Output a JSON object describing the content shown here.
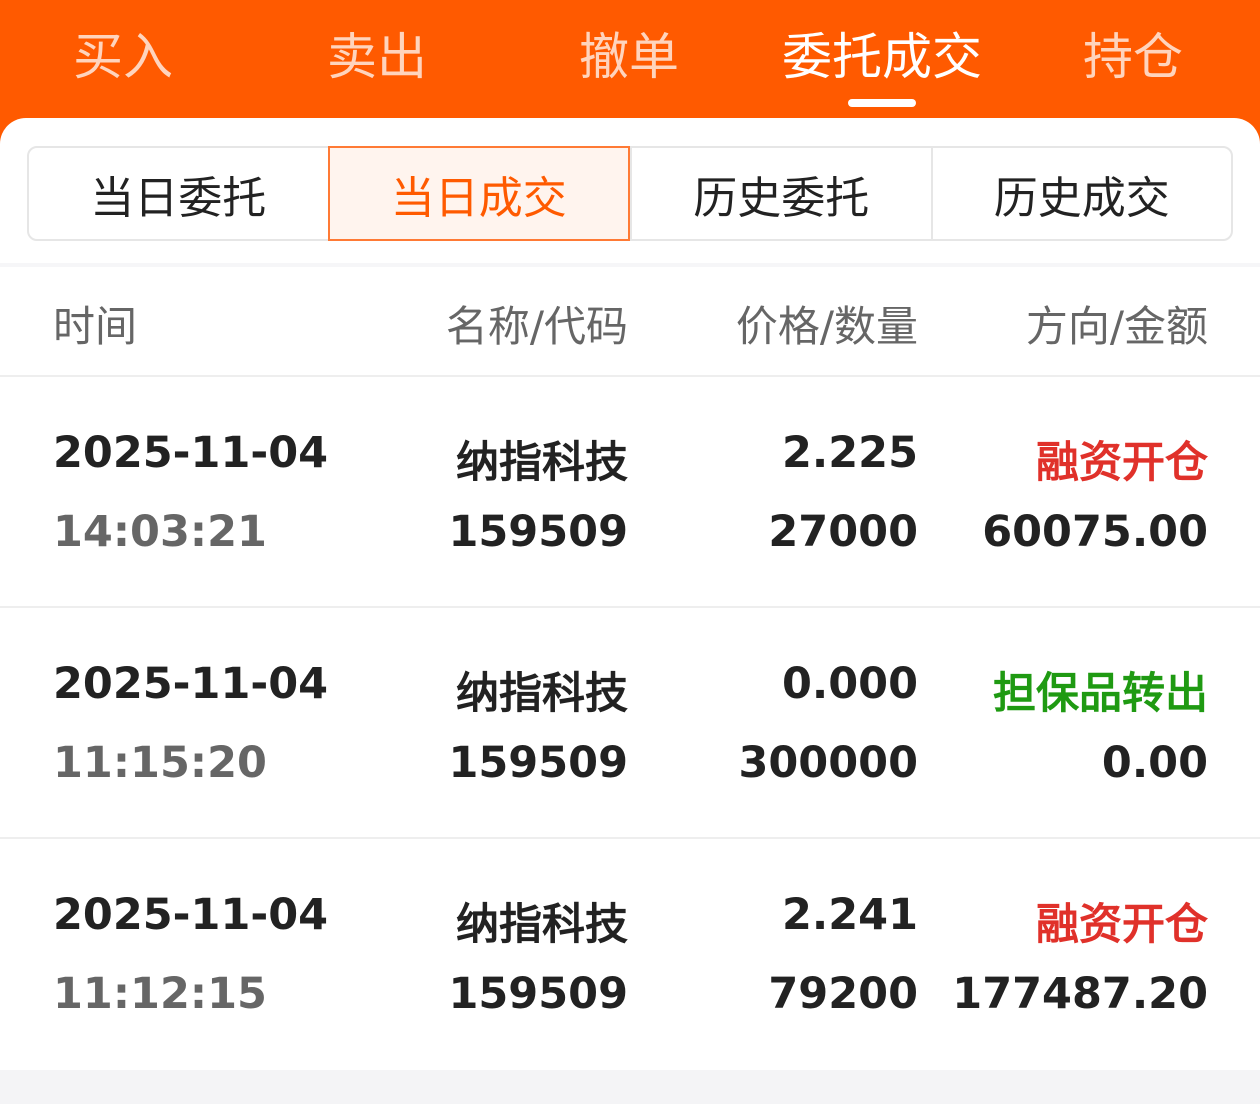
{
  "top_tabs": [
    {
      "label": "买入"
    },
    {
      "label": "卖出"
    },
    {
      "label": "撤单"
    },
    {
      "label": "委托成交",
      "active": true
    },
    {
      "label": "持仓"
    }
  ],
  "segments": [
    {
      "label": "当日委托"
    },
    {
      "label": "当日成交",
      "active": true
    },
    {
      "label": "历史委托"
    },
    {
      "label": "历史成交"
    }
  ],
  "table": {
    "headers": {
      "time": "时间",
      "name_code": "名称/代码",
      "price_qty": "价格/数量",
      "direction_amount": "方向/金额"
    },
    "rows": [
      {
        "date": "2025-11-04",
        "time": "14:03:21",
        "name": "纳指科技",
        "code": "159509",
        "price": "2.225",
        "qty": "27000",
        "direction": "融资开仓",
        "direction_color": "#e0312a",
        "amount": "60075.00"
      },
      {
        "date": "2025-11-04",
        "time": "11:15:20",
        "name": "纳指科技",
        "code": "159509",
        "price": "0.000",
        "qty": "300000",
        "direction": "担保品转出",
        "direction_color": "#1f9a12",
        "amount": "0.00"
      },
      {
        "date": "2025-11-04",
        "time": "11:12:15",
        "name": "纳指科技",
        "code": "159509",
        "price": "2.241",
        "qty": "79200",
        "direction": "融资开仓",
        "direction_color": "#e0312a",
        "amount": "177487.20"
      }
    ]
  },
  "colors": {
    "brand": "#ff5a00",
    "buy_red": "#e0312a",
    "transfer_green": "#1f9a12"
  }
}
